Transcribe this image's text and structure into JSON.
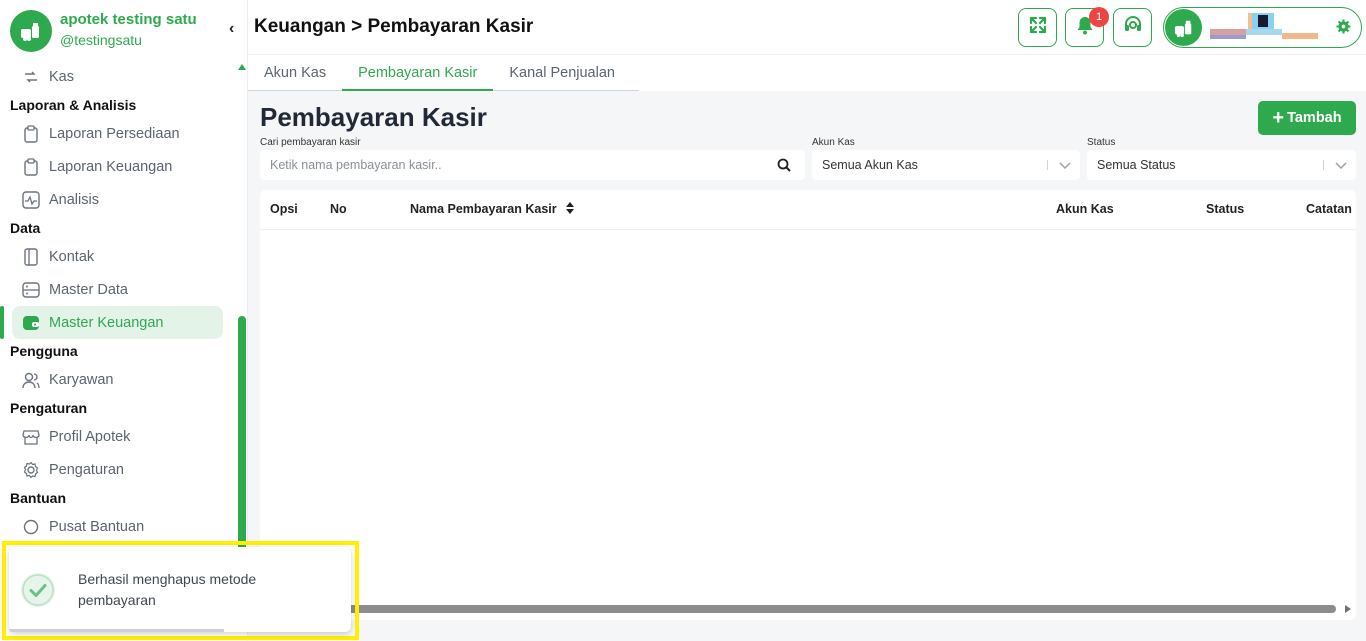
{
  "brand": {
    "name": "apotek testing satu",
    "handle": "@testingsatu",
    "logo_icon": "pharmacy-logo-icon"
  },
  "sidebar": {
    "collapse_icon": "chevron-left-icon",
    "items": [
      {
        "label": "Kas",
        "icon": "cash-flow-icon"
      }
    ],
    "sections": [
      {
        "title": "Laporan & Analisis",
        "items": [
          {
            "label": "Laporan Persediaan",
            "icon": "clipboard-icon"
          },
          {
            "label": "Laporan Keuangan",
            "icon": "clipboard-icon"
          },
          {
            "label": "Analisis",
            "icon": "activity-icon"
          }
        ]
      },
      {
        "title": "Data",
        "items": [
          {
            "label": "Kontak",
            "icon": "contact-book-icon"
          },
          {
            "label": "Master Data",
            "icon": "server-icon"
          },
          {
            "label": "Master Keuangan",
            "icon": "wallet-icon",
            "active": true
          }
        ]
      },
      {
        "title": "Pengguna",
        "items": [
          {
            "label": "Karyawan",
            "icon": "users-icon"
          }
        ]
      },
      {
        "title": "Pengaturan",
        "items": [
          {
            "label": "Profil Apotek",
            "icon": "store-icon"
          },
          {
            "label": "Pengaturan",
            "icon": "gear-icon"
          }
        ]
      },
      {
        "title": "Bantuan",
        "items": [
          {
            "label": "Pusat Bantuan",
            "icon": "help-icon"
          }
        ]
      }
    ]
  },
  "header": {
    "breadcrumb": "Keuangan > Pembayaran Kasir",
    "notification_count": "1"
  },
  "tabs": [
    {
      "label": "Akun Kas"
    },
    {
      "label": "Pembayaran Kasir",
      "active": true
    },
    {
      "label": "Kanal Penjualan"
    }
  ],
  "page": {
    "title": "Pembayaran Kasir",
    "add_label": "Tambah"
  },
  "filters": {
    "search_label": "Cari pembayaran kasir",
    "search_placeholder": "Ketik nama pembayaran kasir..",
    "account_label": "Akun Kas",
    "account_value": "Semua Akun Kas",
    "status_label": "Status",
    "status_value": "Semua Status"
  },
  "table": {
    "columns": [
      "Opsi",
      "No",
      "Nama Pembayaran Kasir",
      "Akun Kas",
      "Status",
      "Catatan"
    ],
    "rows": []
  },
  "toast": {
    "message": "Berhasil menghapus metode pembayaran",
    "icon": "check-circle-icon"
  },
  "colors": {
    "accent": "#2fa94e",
    "badge": "#ef4444",
    "highlight": "#ffef00"
  }
}
